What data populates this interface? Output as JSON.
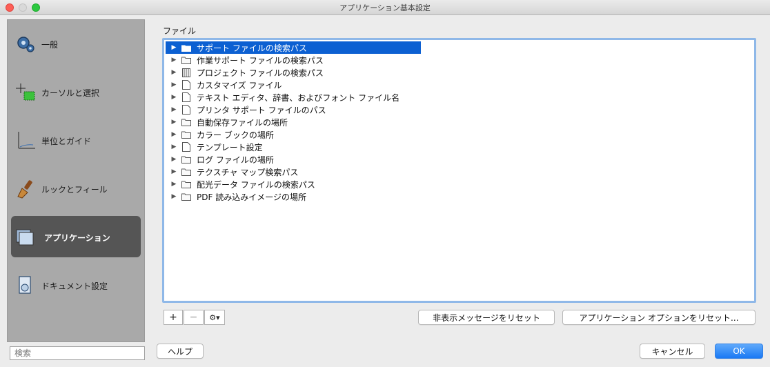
{
  "window": {
    "title": "アプリケーション基本設定"
  },
  "sidebar": {
    "items": [
      {
        "label": "一般",
        "icon": "gear-icon",
        "selected": false
      },
      {
        "label": "カーソルと選択",
        "icon": "cursor-selection-icon",
        "selected": false
      },
      {
        "label": "単位とガイド",
        "icon": "units-guides-icon",
        "selected": false
      },
      {
        "label": "ルックとフィール",
        "icon": "brush-icon",
        "selected": false
      },
      {
        "label": "アプリケーション",
        "icon": "application-windows-icon",
        "selected": true
      },
      {
        "label": "ドキュメント設定",
        "icon": "document-settings-icon",
        "selected": false
      }
    ],
    "search_placeholder": "検索"
  },
  "main": {
    "section_label": "ファイル",
    "tree": [
      {
        "label": "サポート ファイルの検索パス",
        "icon": "folder-icon",
        "selected": true
      },
      {
        "label": "作業サポート ファイルの検索パス",
        "icon": "folder-icon",
        "selected": false
      },
      {
        "label": "プロジェクト ファイルの検索パス",
        "icon": "project-file-icon",
        "selected": false
      },
      {
        "label": "カスタマイズ ファイル",
        "icon": "document-icon",
        "selected": false
      },
      {
        "label": "テキスト エディタ、辞書、およびフォント ファイル名",
        "icon": "document-icon",
        "selected": false
      },
      {
        "label": "プリンタ サポート ファイルのパス",
        "icon": "document-icon",
        "selected": false
      },
      {
        "label": "自動保存ファイルの場所",
        "icon": "folder-icon",
        "selected": false
      },
      {
        "label": "カラー ブックの場所",
        "icon": "folder-icon",
        "selected": false
      },
      {
        "label": "テンプレート設定",
        "icon": "document-icon",
        "selected": false
      },
      {
        "label": "ログ ファイルの場所",
        "icon": "folder-icon",
        "selected": false
      },
      {
        "label": "テクスチャ マップ検索パス",
        "icon": "folder-icon",
        "selected": false
      },
      {
        "label": "配光データ ファイルの検索パス",
        "icon": "folder-icon",
        "selected": false
      },
      {
        "label": "PDF 読み込みイメージの場所",
        "icon": "folder-icon",
        "selected": false
      }
    ],
    "add_label": "+",
    "remove_label": "−",
    "gear_menu_label": "⚙▾",
    "reset_hidden_messages": "非表示メッセージをリセット",
    "reset_app_options": "アプリケーション オプションをリセット..."
  },
  "footer": {
    "help": "ヘルプ",
    "cancel": "キャンセル",
    "ok": "OK"
  },
  "colors": {
    "selection": "#0c60d2",
    "sidebar": "#a9a9a9",
    "sidebar_selected": "#555555",
    "ok_button": "#1a79f4"
  }
}
